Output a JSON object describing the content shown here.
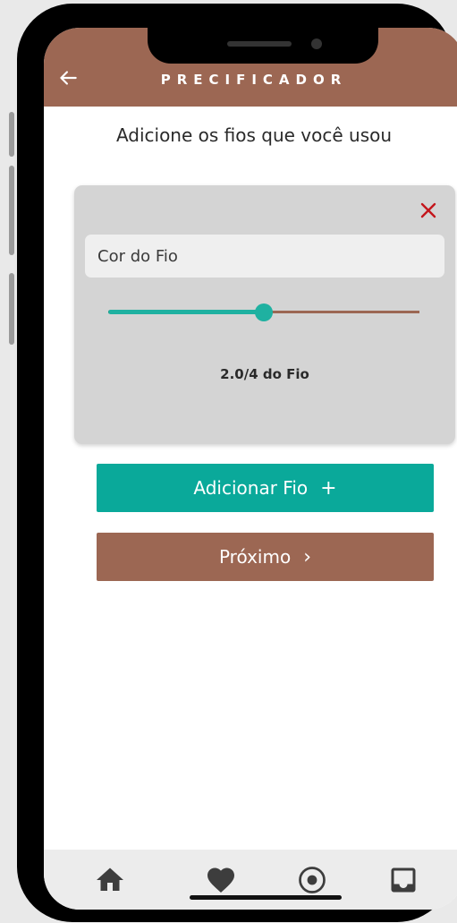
{
  "header": {
    "title": "PRECIFICADOR",
    "back_icon": "arrow-left-icon"
  },
  "page": {
    "subtitle": "Adicione os fios que você usou"
  },
  "yarn_card": {
    "close_icon": "close-icon",
    "color_input": {
      "value": "",
      "placeholder": "Cor do Fio"
    },
    "slider": {
      "value": 2.0,
      "max": 4,
      "fraction": 0.5
    },
    "slider_label": "2.0/4 do Fio"
  },
  "buttons": {
    "add_label": "Adicionar Fio",
    "add_glyph": "+",
    "next_label": "Próximo",
    "next_glyph": "›"
  },
  "bottom_nav": {
    "items": [
      {
        "icon": "home-icon"
      },
      {
        "icon": "heart-icon"
      },
      {
        "icon": "target-icon"
      },
      {
        "icon": "inbox-icon"
      }
    ]
  },
  "colors": {
    "brown": "#9c6753",
    "teal": "#0aa99a",
    "slider_teal": "#1fb1a1",
    "close_red": "#c4161c"
  }
}
